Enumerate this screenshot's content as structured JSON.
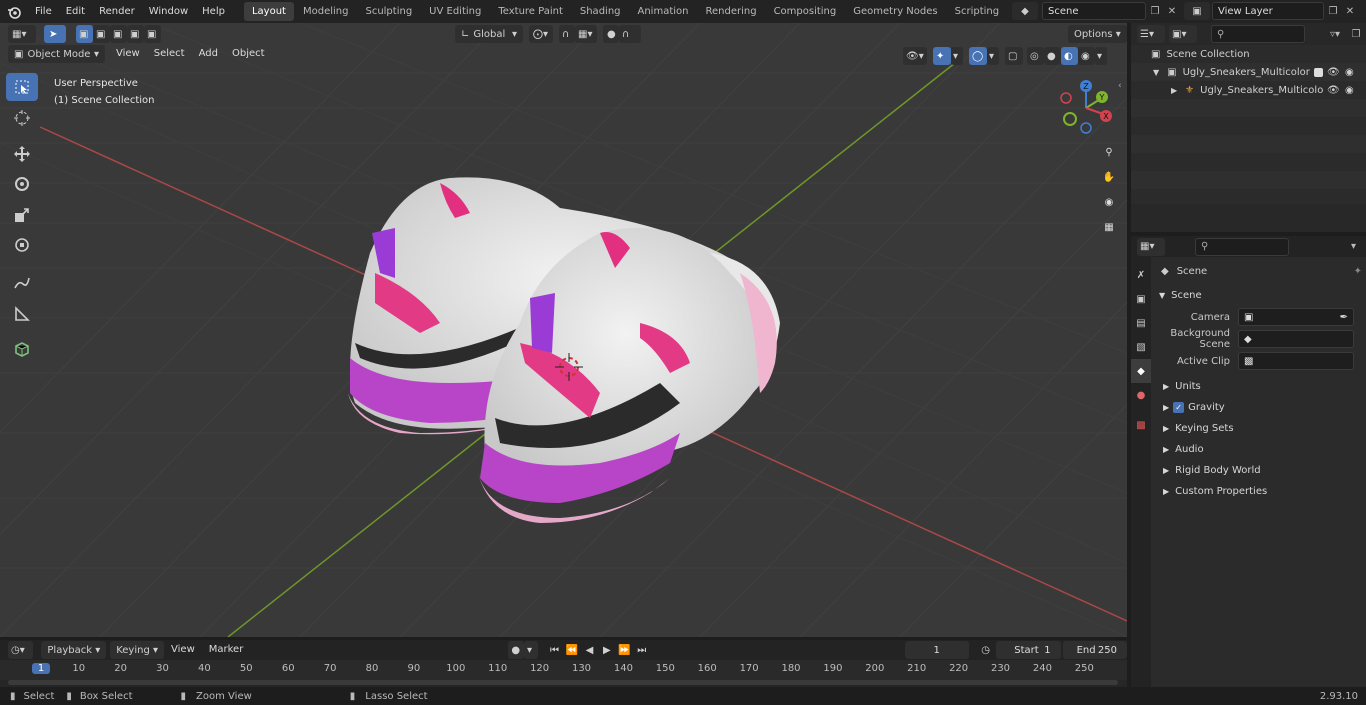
{
  "topbar": {
    "menus": [
      "File",
      "Edit",
      "Render",
      "Window",
      "Help"
    ],
    "workspaces": [
      "Layout",
      "Modeling",
      "Sculpting",
      "UV Editing",
      "Texture Paint",
      "Shading",
      "Animation",
      "Rendering",
      "Compositing",
      "Geometry Nodes",
      "Scripting"
    ],
    "active_workspace": "Layout",
    "scene_name": "Scene",
    "view_layer": "View Layer"
  },
  "viewport": {
    "mode": "Object Mode",
    "menus": [
      "View",
      "Select",
      "Add",
      "Object"
    ],
    "orientation": "Global",
    "options_label": "Options",
    "info_line1": "User Perspective",
    "info_line2": "(1) Scene Collection",
    "gizmo": {
      "z": "Z",
      "y": "Y",
      "x": "X"
    }
  },
  "outliner": {
    "root": "Scene Collection",
    "items": [
      {
        "label": "Ugly_Sneakers_Multicolor"
      },
      {
        "label": "Ugly_Sneakers_Multicolo"
      }
    ]
  },
  "properties": {
    "context": "Scene",
    "section": "Scene",
    "fields": [
      {
        "label": "Camera"
      },
      {
        "label": "Background Scene"
      },
      {
        "label": "Active Clip"
      }
    ],
    "panels": [
      "Units",
      "Gravity",
      "Keying Sets",
      "Audio",
      "Rigid Body World",
      "Custom Properties"
    ]
  },
  "timeline": {
    "menus": [
      "Playback",
      "Keying",
      "View",
      "Marker"
    ],
    "current_frame": "1",
    "start_label": "Start",
    "start": "1",
    "end_label": "End",
    "end": "250",
    "ruler": [
      "1",
      "10",
      "20",
      "30",
      "40",
      "50",
      "60",
      "70",
      "80",
      "90",
      "100",
      "110",
      "120",
      "130",
      "140",
      "150",
      "160",
      "170",
      "180",
      "190",
      "200",
      "210",
      "220",
      "230",
      "240",
      "250"
    ]
  },
  "status": {
    "items": [
      "Select",
      "Box Select",
      "Zoom View",
      "Lasso Select"
    ],
    "version": "2.93.10"
  },
  "colors": {
    "accent": "#4772b3",
    "bg_viewport": "#393939",
    "x_axis": "#b94747",
    "y_axis": "#7aa12a"
  }
}
